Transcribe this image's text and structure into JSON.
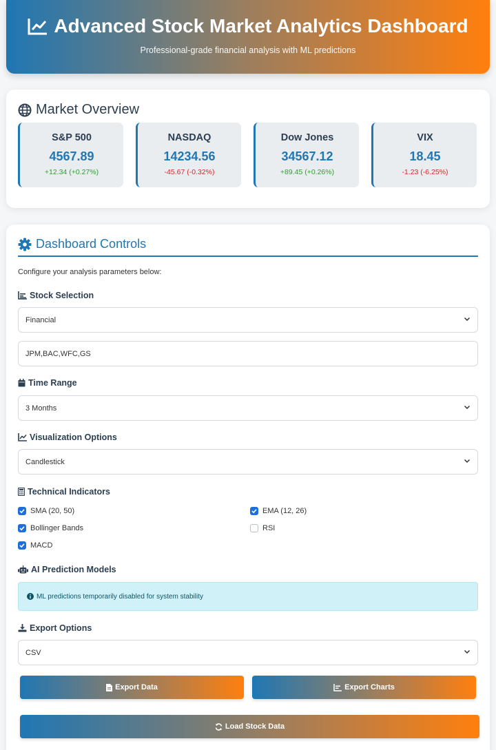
{
  "header": {
    "title": "Advanced Stock Market Analytics Dashboard",
    "subtitle": "Professional-grade financial analysis with ML predictions"
  },
  "overview": {
    "title": "Market Overview",
    "indices": [
      {
        "name": "S&P 500",
        "value": "4567.89",
        "change": "+12.34 (+0.27%)",
        "direction": "up"
      },
      {
        "name": "NASDAQ",
        "value": "14234.56",
        "change": "-45.67 (-0.32%)",
        "direction": "down"
      },
      {
        "name": "Dow Jones",
        "value": "34567.12",
        "change": "+89.45 (+0.26%)",
        "direction": "up"
      },
      {
        "name": "VIX",
        "value": "18.45",
        "change": "-1.23 (-6.25%)",
        "direction": "down"
      }
    ]
  },
  "controls": {
    "title": "Dashboard Controls",
    "intro": "Configure your analysis parameters below:",
    "stock_selection": {
      "label": "Stock Selection",
      "sector": "Financial",
      "tickers": "JPM,BAC,WFC,GS"
    },
    "time_range": {
      "label": "Time Range",
      "value": "3 Months"
    },
    "visualization": {
      "label": "Visualization Options",
      "value": "Candlestick"
    },
    "indicators": {
      "label": "Technical Indicators",
      "items": [
        {
          "label": "SMA (20, 50)",
          "checked": true
        },
        {
          "label": "EMA (12, 26)",
          "checked": true
        },
        {
          "label": "Bollinger Bands",
          "checked": true
        },
        {
          "label": "RSI",
          "checked": false
        },
        {
          "label": "MACD",
          "checked": true
        }
      ]
    },
    "ai": {
      "label": "AI Prediction Models",
      "message": "ML predictions temporarily disabled for system stability"
    },
    "export": {
      "label": "Export Options",
      "format": "CSV",
      "export_data_label": "Export Data",
      "export_charts_label": "Export Charts"
    },
    "load_label": "Load Stock Data"
  },
  "colors": {
    "primary": "#1f77b4",
    "accent": "#ff7f0e",
    "positive": "#2ca02c",
    "negative": "#d62728"
  }
}
